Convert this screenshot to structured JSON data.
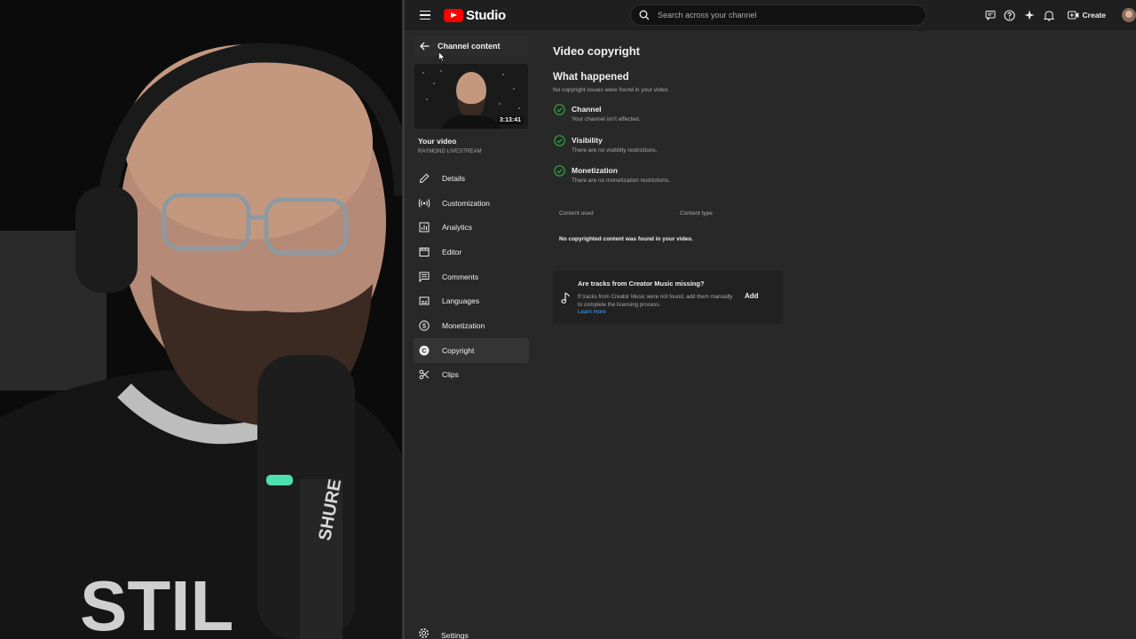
{
  "brand": {
    "logo_text": "Studio",
    "accent": "#ff0000"
  },
  "search": {
    "placeholder": "Search across your channel"
  },
  "topbar": {
    "icons": [
      "feedback-icon",
      "help-icon",
      "sparkle-icon",
      "bell-icon"
    ],
    "create_label": "Create"
  },
  "sidebar": {
    "back_label": "Channel content",
    "thumbnail_duration": "3:13:41",
    "your_video_label": "Your video",
    "video_title": "RAYMOND LIVESTREAM",
    "items": [
      {
        "label": "Details",
        "icon": "pencil-icon"
      },
      {
        "label": "Customization",
        "icon": "broadcast-icon"
      },
      {
        "label": "Analytics",
        "icon": "analytics-icon"
      },
      {
        "label": "Editor",
        "icon": "editor-icon"
      },
      {
        "label": "Comments",
        "icon": "comments-icon"
      },
      {
        "label": "Languages",
        "icon": "subtitles-icon"
      },
      {
        "label": "Monetization",
        "icon": "dollar-icon"
      },
      {
        "label": "Copyright",
        "icon": "copyright-icon",
        "active": true
      },
      {
        "label": "Clips",
        "icon": "scissors-icon"
      }
    ],
    "settings_label": "Settings"
  },
  "main": {
    "page_title": "Video copyright",
    "what_happened_title": "What happened",
    "what_happened_sub": "No copyright issues were found in your video.",
    "statuses": [
      {
        "title": "Channel",
        "desc": "Your channel isn't affected."
      },
      {
        "title": "Visibility",
        "desc": "There are no visibility restrictions."
      },
      {
        "title": "Monetization",
        "desc": "There are no monetization restrictions."
      }
    ],
    "table": {
      "col_content_used": "Content used",
      "col_content_type": "Content type",
      "empty_message": "No copyrighted content was found in your video."
    },
    "music_card": {
      "title": "Are tracks from Creator Music missing?",
      "body": "If tracks from Creator Music were not found, add them manually to complete the licensing process.",
      "link": "Learn more",
      "add_label": "Add"
    }
  },
  "colors": {
    "status_ok": "#2ba640",
    "link": "#3ea6ff"
  }
}
